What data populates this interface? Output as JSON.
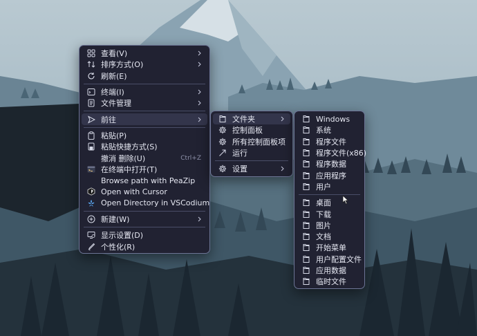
{
  "main_menu": {
    "groups": [
      [
        {
          "icon": "view-icon",
          "label": "查看(V)",
          "submenu": true
        },
        {
          "icon": "sort-icon",
          "label": "排序方式(O)",
          "submenu": true
        },
        {
          "icon": "refresh-icon",
          "label": "刷新(E)",
          "submenu": false
        }
      ],
      [
        {
          "icon": "terminal-icon",
          "label": "终端(I)",
          "submenu": true
        },
        {
          "icon": "file-manager-icon",
          "label": "文件管理",
          "submenu": true
        }
      ],
      [
        {
          "icon": "goto-icon",
          "label": "前往",
          "submenu": true,
          "active": true
        }
      ],
      [
        {
          "icon": "paste-icon",
          "label": "粘贴(P)",
          "submenu": false
        },
        {
          "icon": "paste-shortcut-icon",
          "label": "粘贴快捷方式(S)",
          "submenu": false
        },
        {
          "icon": "",
          "label": "撤消 删除(U)",
          "submenu": false,
          "shortcut": "Ctrl+Z"
        },
        {
          "icon": "terminal-open-icon",
          "label": "在终端中打开(T)",
          "submenu": false
        },
        {
          "icon": "",
          "label": "Browse path with PeaZip",
          "submenu": false
        },
        {
          "icon": "cursor-icon",
          "label": "Open with Cursor",
          "submenu": false
        },
        {
          "icon": "vscodium-icon",
          "label": "Open Directory in VSCodium",
          "submenu": false
        }
      ],
      [
        {
          "icon": "new-icon",
          "label": "新建(W)",
          "submenu": true
        }
      ],
      [
        {
          "icon": "display-icon",
          "label": "显示设置(D)",
          "submenu": false
        },
        {
          "icon": "personalize-icon",
          "label": "个性化(R)",
          "submenu": false
        }
      ]
    ]
  },
  "goto_menu": {
    "groups": [
      [
        {
          "icon": "folder-icon",
          "label": "文件夹",
          "submenu": true,
          "active": true
        },
        {
          "icon": "gear-icon",
          "label": "控制面板",
          "submenu": false
        },
        {
          "icon": "gear-icon",
          "label": "所有控制面板项",
          "submenu": false
        },
        {
          "icon": "run-icon",
          "label": "运行",
          "submenu": false
        }
      ],
      [
        {
          "icon": "gear-icon",
          "label": "设置",
          "submenu": true
        }
      ]
    ]
  },
  "folder_menu": {
    "groups": [
      [
        {
          "icon": "folder-icon",
          "label": "Windows"
        },
        {
          "icon": "folder-icon",
          "label": "系统"
        },
        {
          "icon": "folder-icon",
          "label": "程序文件"
        },
        {
          "icon": "folder-icon",
          "label": "程序文件(x86)"
        },
        {
          "icon": "folder-icon",
          "label": "程序数据"
        },
        {
          "icon": "folder-icon",
          "label": "应用程序"
        },
        {
          "icon": "folder-icon",
          "label": "用户"
        }
      ],
      [
        {
          "icon": "folder-icon",
          "label": "桌面"
        },
        {
          "icon": "folder-icon",
          "label": "下载"
        },
        {
          "icon": "folder-icon",
          "label": "图片"
        },
        {
          "icon": "folder-icon",
          "label": "文档"
        },
        {
          "icon": "folder-icon",
          "label": "开始菜单"
        },
        {
          "icon": "folder-icon",
          "label": "用户配置文件"
        },
        {
          "icon": "folder-icon",
          "label": "应用数据"
        },
        {
          "icon": "folder-icon",
          "label": "临时文件"
        }
      ]
    ]
  }
}
